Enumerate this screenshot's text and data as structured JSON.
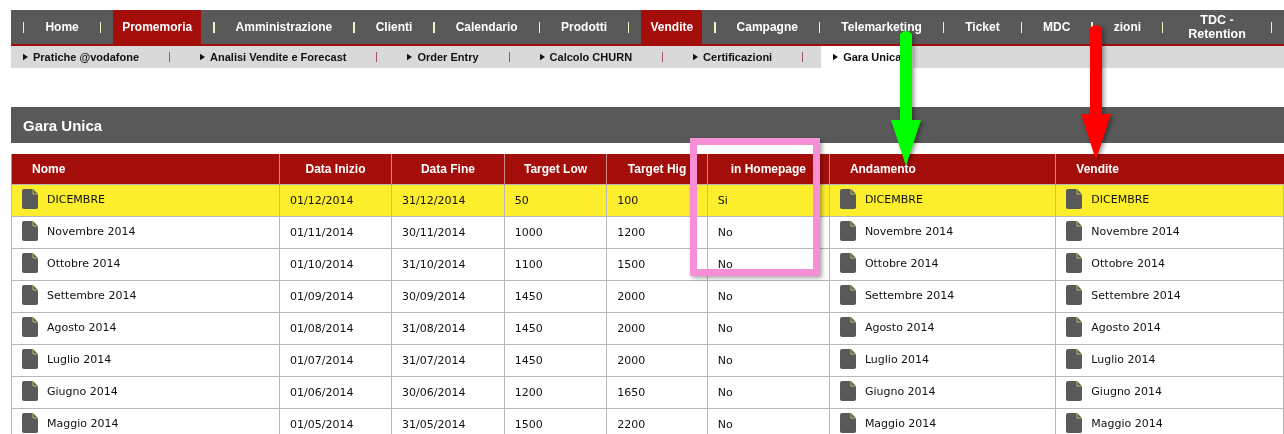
{
  "nav": [
    {
      "label": "Home",
      "selected": false
    },
    {
      "label": "Promemoria",
      "selected": true
    },
    {
      "label": "Amministrazione",
      "selected": false
    },
    {
      "label": "Clienti",
      "selected": false
    },
    {
      "label": "Calendario",
      "selected": false
    },
    {
      "label": "Prodotti",
      "selected": false
    },
    {
      "label": "Vendite",
      "selected": true
    },
    {
      "label": "Campagne",
      "selected": false
    },
    {
      "label": "Telemarketing",
      "selected": false
    },
    {
      "label": "Ticket",
      "selected": false
    },
    {
      "label": "MDC",
      "selected": false
    },
    {
      "label": "zioni",
      "selected": false
    },
    {
      "label": "TDC - Retention",
      "selected": false
    }
  ],
  "subnav": [
    {
      "label": "Pratiche @vodafone",
      "selected": false
    },
    {
      "label": "Analisi Vendite e Forecast",
      "selected": false
    },
    {
      "label": "Order Entry",
      "selected": false
    },
    {
      "label": "Calcolo CHURN",
      "selected": false
    },
    {
      "label": "Certificazioni",
      "selected": false
    },
    {
      "label": "Gara Unica",
      "selected": true
    }
  ],
  "section_title": "Gara Unica",
  "table": {
    "columns": [
      "Nome",
      "Data Inizio",
      "Data Fine",
      "Target Low",
      "Target Hig",
      "in Homepage",
      "Andamento",
      "Vendite"
    ],
    "rows": [
      {
        "highlighted": true,
        "cells": [
          "DICEMBRE",
          "01/12/2014",
          "31/12/2014",
          "50",
          "100",
          "Si",
          "DICEMBRE",
          "DICEMBRE"
        ]
      },
      {
        "highlighted": false,
        "cells": [
          "Novembre 2014",
          "01/11/2014",
          "30/11/2014",
          "1000",
          "1200",
          "No",
          "Novembre 2014",
          "Novembre 2014"
        ]
      },
      {
        "highlighted": false,
        "cells": [
          "Ottobre 2014",
          "01/10/2014",
          "31/10/2014",
          "1100",
          "1500",
          "No",
          "Ottobre 2014",
          "Ottobre 2014"
        ]
      },
      {
        "highlighted": false,
        "cells": [
          "Settembre 2014",
          "01/09/2014",
          "30/09/2014",
          "1450",
          "2000",
          "No",
          "Settembre 2014",
          "Settembre 2014"
        ]
      },
      {
        "highlighted": false,
        "cells": [
          "Agosto 2014",
          "01/08/2014",
          "31/08/2014",
          "1450",
          "2000",
          "No",
          "Agosto 2014",
          "Agosto 2014"
        ]
      },
      {
        "highlighted": false,
        "cells": [
          "Luglio 2014",
          "01/07/2014",
          "31/07/2014",
          "1450",
          "2000",
          "No",
          "Luglio 2014",
          "Luglio 2014"
        ]
      },
      {
        "highlighted": false,
        "cells": [
          "Giugno 2014",
          "01/06/2014",
          "30/06/2014",
          "1200",
          "1650",
          "No",
          "Giugno 2014",
          "Giugno 2014"
        ]
      },
      {
        "highlighted": false,
        "cells": [
          "Maggio 2014",
          "01/05/2014",
          "31/05/2014",
          "1500",
          "2200",
          "No",
          "Maggio 2014",
          "Maggio 2014"
        ]
      }
    ]
  },
  "annotations": [
    {
      "kind": "box",
      "color": "#f78fd6"
    },
    {
      "kind": "arrow",
      "color": "#00ff00"
    },
    {
      "kind": "arrow",
      "color": "#ff0000"
    }
  ]
}
